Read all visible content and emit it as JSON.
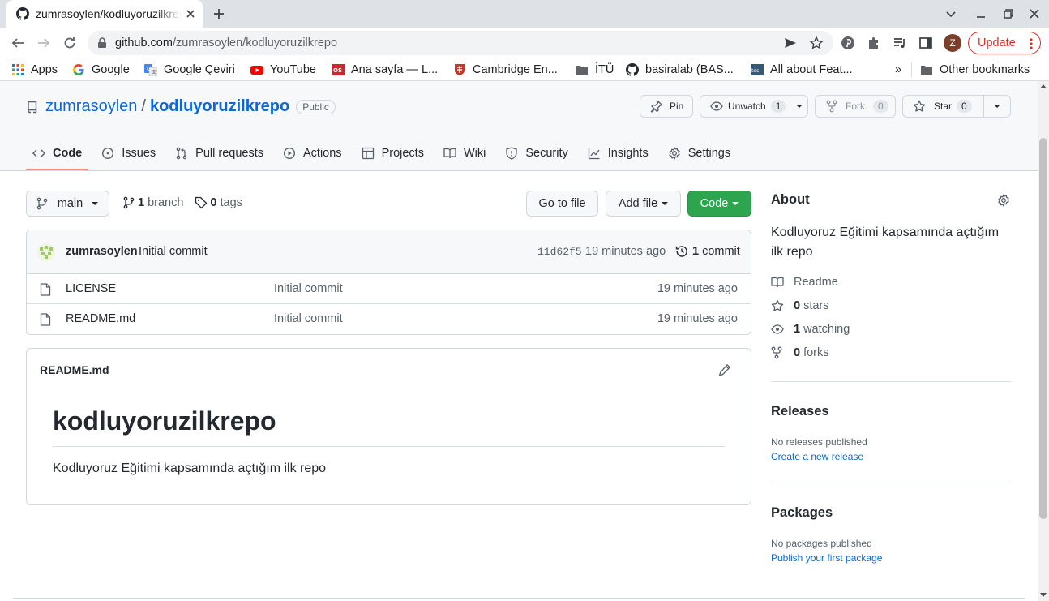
{
  "browser": {
    "tab_title": "zumrasoylen/kodluyoruzilkrepo",
    "url_host": "github.com",
    "url_path": "/zumrasoylen/kodluyoruzilkrepo",
    "profile_initial": "Z",
    "update_label": "Update",
    "accent_update": "#d93025"
  },
  "bookmarks": {
    "items": [
      {
        "label": "Apps",
        "icon": "apps-grid-icon"
      },
      {
        "label": "Google",
        "icon": "google-icon"
      },
      {
        "label": "Google Çeviri",
        "icon": "google-translate-icon"
      },
      {
        "label": "YouTube",
        "icon": "youtube-icon"
      },
      {
        "label": "Ana sayfa — L...",
        "icon": "os-icon"
      },
      {
        "label": "Cambridge En...",
        "icon": "cambridge-icon"
      },
      {
        "label": "İTÜ",
        "icon": "folder-icon"
      },
      {
        "label": "basiralab (BAS...",
        "icon": "github-icon"
      },
      {
        "label": "All about Feat...",
        "icon": "tds-icon"
      }
    ],
    "overflow": "»",
    "other": "Other bookmarks"
  },
  "repo": {
    "owner": "zumrasoylen",
    "separator": "/",
    "name": "kodluyoruzilkrepo",
    "visibility": "Public",
    "pin_label": "Pin",
    "unwatch_label": "Unwatch",
    "watch_count": "1",
    "fork_label": "Fork",
    "fork_count": "0",
    "star_label": "Star",
    "star_count": "0"
  },
  "nav": {
    "tabs": [
      {
        "label": "Code",
        "icon": "code-icon",
        "selected": true
      },
      {
        "label": "Issues",
        "icon": "issue-icon"
      },
      {
        "label": "Pull requests",
        "icon": "pull-request-icon"
      },
      {
        "label": "Actions",
        "icon": "play-icon"
      },
      {
        "label": "Projects",
        "icon": "table-icon"
      },
      {
        "label": "Wiki",
        "icon": "book-icon"
      },
      {
        "label": "Security",
        "icon": "shield-icon"
      },
      {
        "label": "Insights",
        "icon": "graph-icon"
      },
      {
        "label": "Settings",
        "icon": "gear-icon"
      }
    ]
  },
  "toolbar": {
    "branch": "main",
    "branch_count": "1",
    "branch_word": "branch",
    "tag_count": "0",
    "tag_word": "tags",
    "go_to_file": "Go to file",
    "add_file": "Add file",
    "code": "Code"
  },
  "commit": {
    "author": "zumrasoylen",
    "message": "Initial commit",
    "sha": "11d62f5",
    "time": "19 minutes ago",
    "count": "1",
    "count_word": "commit"
  },
  "files": [
    {
      "name": "LICENSE",
      "message": "Initial commit",
      "time": "19 minutes ago"
    },
    {
      "name": "README.md",
      "message": "Initial commit",
      "time": "19 minutes ago"
    }
  ],
  "readme": {
    "header": "README.md",
    "title": "kodluyoruzilkrepo",
    "body": "Kodluyoruz Eğitimi kapsamında açtığım ilk repo"
  },
  "about": {
    "heading": "About",
    "description": "Kodluyoruz Eğitimi kapsamında açtığım ilk repo",
    "readme": "Readme",
    "stars_count": "0",
    "stars_word": "stars",
    "watching_count": "1",
    "watching_word": "watching",
    "forks_count": "0",
    "forks_word": "forks"
  },
  "releases": {
    "heading": "Releases",
    "empty": "No releases published",
    "link": "Create a new release"
  },
  "packages": {
    "heading": "Packages",
    "empty": "No packages published",
    "link": "Publish your first package"
  },
  "colors": {
    "link": "#0969da",
    "primary_button": "#2da44e",
    "selected_underline": "#fd8c73"
  }
}
